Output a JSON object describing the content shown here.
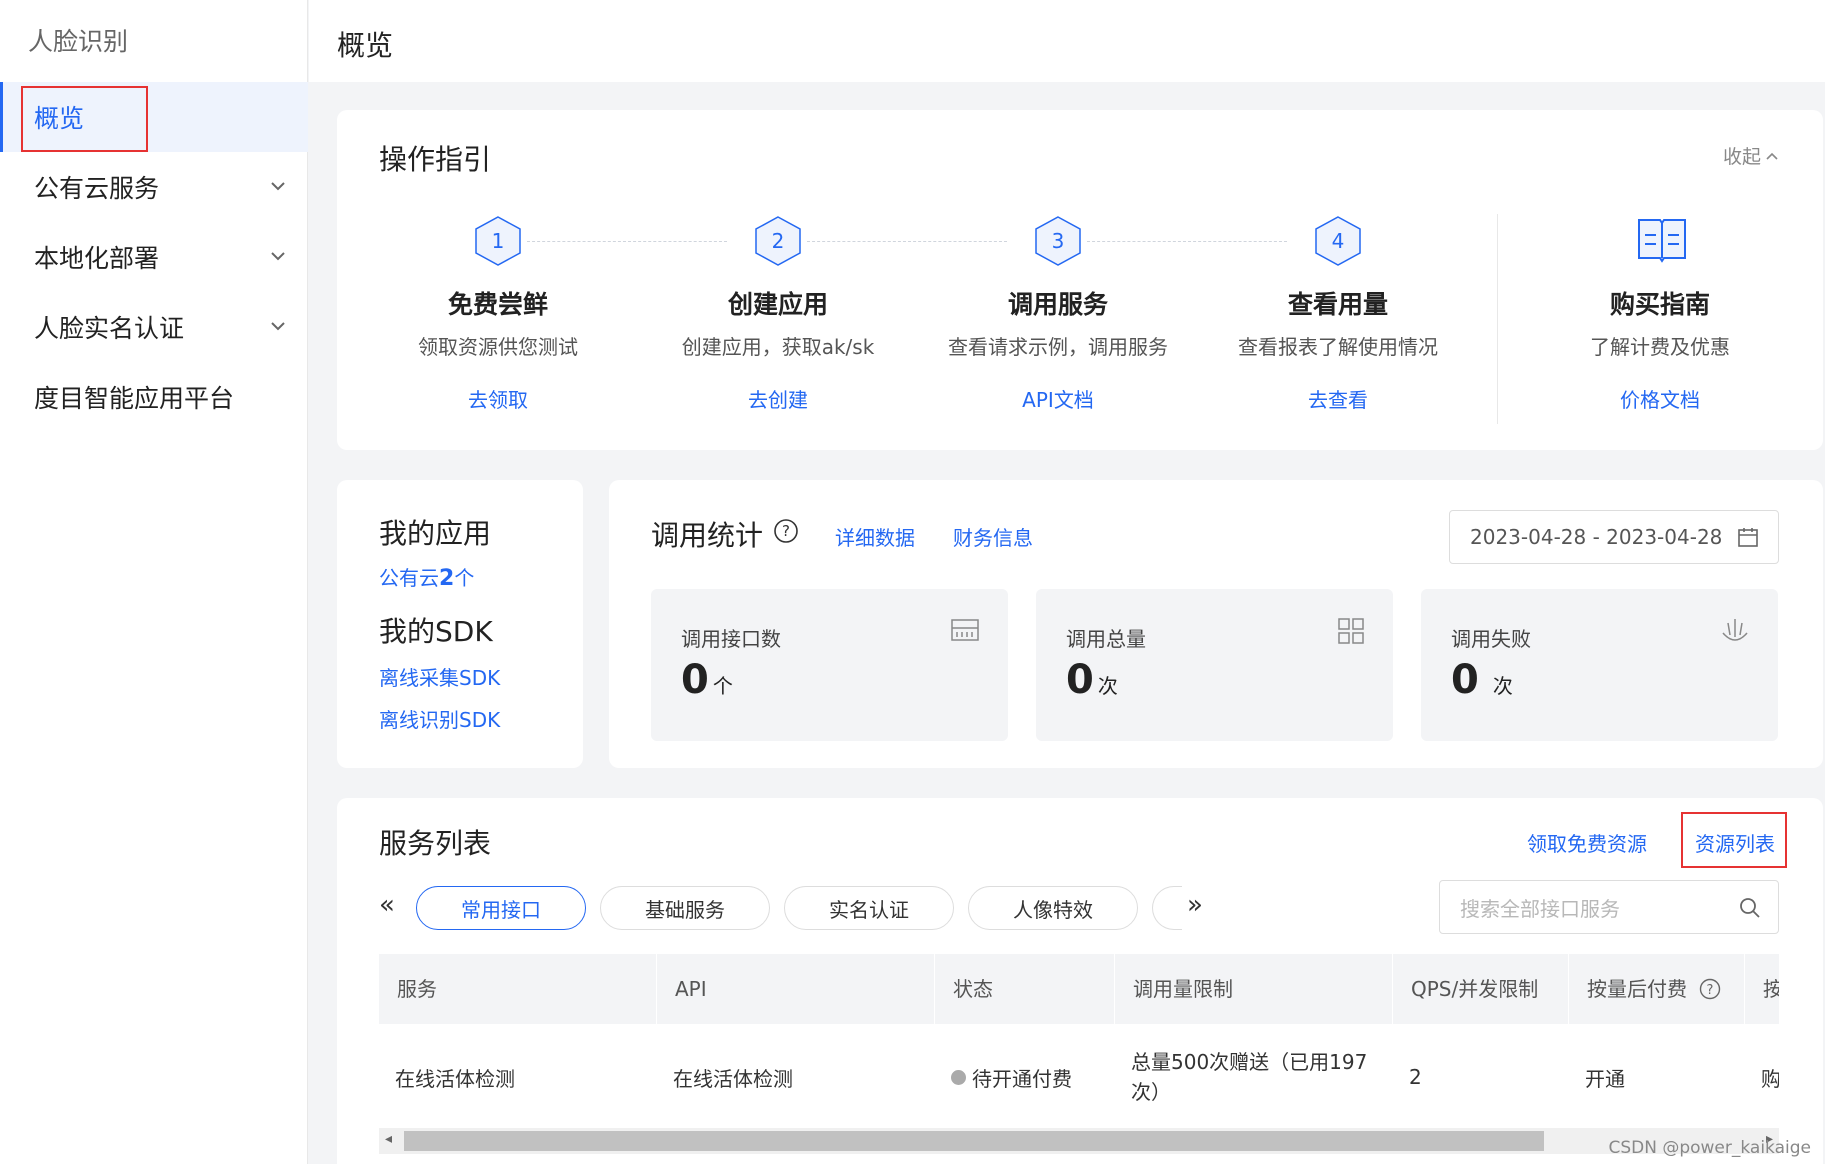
{
  "sidebar": {
    "title": "人脸识别",
    "items": [
      {
        "label": "概览"
      },
      {
        "label": "公有云服务"
      },
      {
        "label": "本地化部署"
      },
      {
        "label": "人脸实名认证"
      },
      {
        "label": "度目智能应用平台"
      }
    ]
  },
  "header": {
    "title": "概览"
  },
  "guide": {
    "title": "操作指引",
    "collapse_label": "收起",
    "steps": [
      {
        "num": "1",
        "name": "免费尝鲜",
        "desc": "领取资源供您测试",
        "link": "去领取"
      },
      {
        "num": "2",
        "name": "创建应用",
        "desc": "创建应用，获取ak/sk",
        "link": "去创建"
      },
      {
        "num": "3",
        "name": "调用服务",
        "desc": "查看请求示例，调用服务",
        "link": "API文档"
      },
      {
        "num": "4",
        "name": "查看用量",
        "desc": "查看报表了解使用情况",
        "link": "去查看"
      }
    ],
    "purchase": {
      "name": "购买指南",
      "desc": "了解计费及优惠",
      "link": "价格文档"
    }
  },
  "apps": {
    "title": "我的应用",
    "cloud_prefix": "公有云",
    "cloud_count": "2",
    "cloud_suffix": "个",
    "sdk_title": "我的SDK",
    "sdk_links": [
      "离线采集SDK",
      "离线识别SDK"
    ]
  },
  "stats": {
    "title": "调用统计",
    "help": "?",
    "detail_link": "详细数据",
    "finance_link": "财务信息",
    "date_range": "2023-04-28 - 2023-04-28",
    "boxes": [
      {
        "label": "调用接口数",
        "value": "0",
        "unit": "个"
      },
      {
        "label": "调用总量",
        "value": "0",
        "unit": "次"
      },
      {
        "label": "调用失败",
        "value": "0",
        "unit": "次"
      }
    ]
  },
  "services": {
    "title": "服务列表",
    "free_link": "领取免费资源",
    "resource_link": "资源列表",
    "tabs": [
      "常用接口",
      "基础服务",
      "实名认证",
      "人像特效"
    ],
    "search_placeholder": "搜索全部接口服务",
    "columns": [
      "服务",
      "API",
      "状态",
      "调用量限制",
      "QPS/并发限制",
      "按量后付费",
      "按"
    ],
    "row": {
      "service": "在线活体检测",
      "api": "在线活体检测",
      "status": "待开通付费",
      "limit": "总量500次赠送（已用197次）",
      "qps": "2",
      "postpaid": "开通",
      "more": "购"
    }
  },
  "watermark": "CSDN @power_kaikaige",
  "colors": {
    "accent": "#2468f2",
    "highlight": "#e63232"
  }
}
